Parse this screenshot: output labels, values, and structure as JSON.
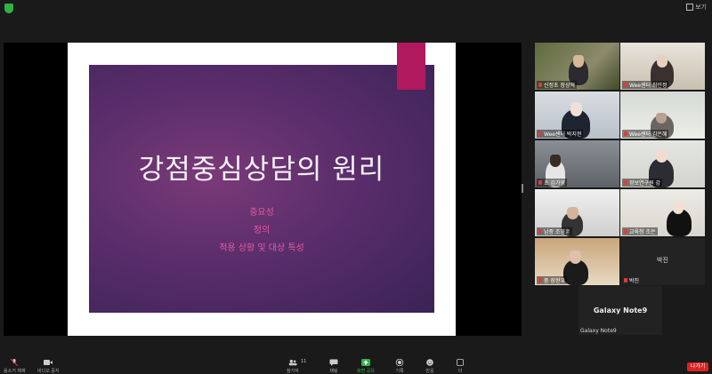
{
  "top": {
    "view_label": "보기"
  },
  "slide": {
    "title": "강점중심상담의 원리",
    "items": [
      "중요성",
      "정의",
      "적용 상황 및 대상 특성"
    ]
  },
  "participants": [
    {
      "name": "신정초 장상혁"
    },
    {
      "name": "Wee센터 최민정"
    },
    {
      "name": "Wee센터 박지현"
    },
    {
      "name": "Wee센터 김은혜"
    },
    {
      "name": "초 김가영"
    },
    {
      "name": "정보연구원 강"
    },
    {
      "name": "남중 조영훈"
    },
    {
      "name": "교육청 조은"
    },
    {
      "name": "중 장현우"
    },
    {
      "name": "박진",
      "center": "박진"
    }
  ],
  "device_tile": {
    "center": "Galaxy Note9",
    "label": "Galaxy Note9"
  },
  "toolbar": {
    "mute": "음소거 해제",
    "video": "비디오 중지",
    "participants": "참가자",
    "participants_count": "11",
    "chat": "채팅",
    "share": "화면 공유",
    "record": "기록",
    "reactions": "반응",
    "more": "더",
    "leave": "나가기"
  }
}
